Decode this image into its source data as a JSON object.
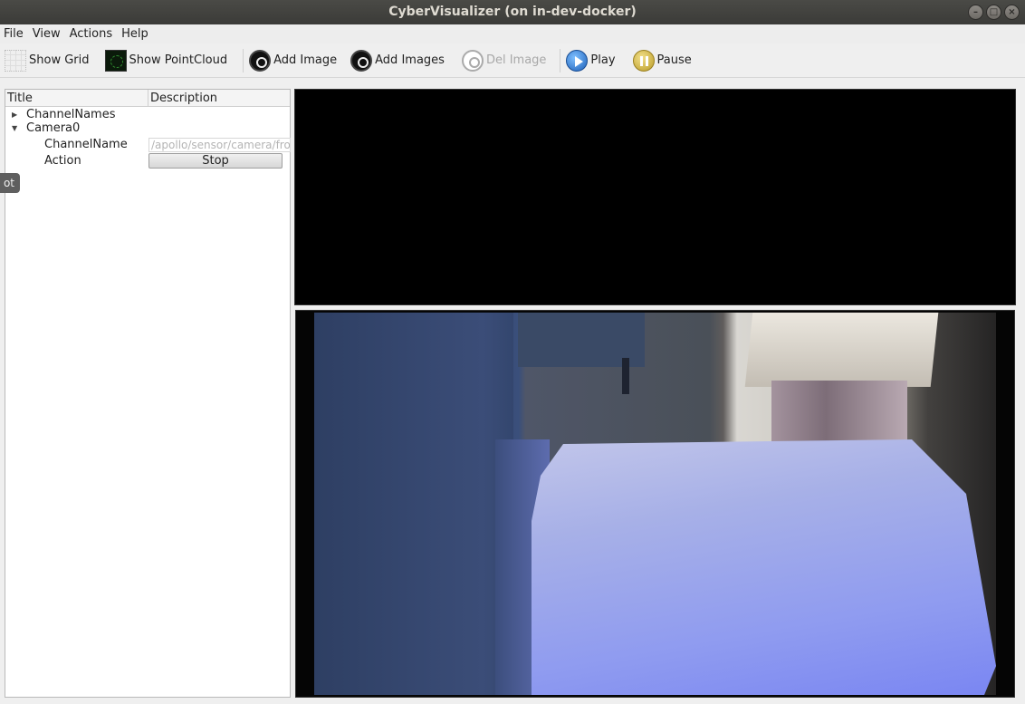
{
  "window": {
    "title": "CyberVisualizer (on in-dev-docker)"
  },
  "menu": [
    "File",
    "View",
    "Actions",
    "Help"
  ],
  "toolbar": {
    "show_grid": "Show Grid",
    "show_pointcloud": "Show PointCloud",
    "add_image": "Add Image",
    "add_images": "Add Images",
    "del_image": "Del Image",
    "play": "Play",
    "pause": "Pause"
  },
  "tree": {
    "columns": [
      "Title",
      "Description"
    ],
    "channel_names": "ChannelNames",
    "camera": "Camera0",
    "channel_name_label": "ChannelName",
    "channel_name_value": "/apollo/sensor/camera/fro",
    "action_label": "Action",
    "action_button": "Stop"
  },
  "tooltip": {
    "text": "ot"
  }
}
